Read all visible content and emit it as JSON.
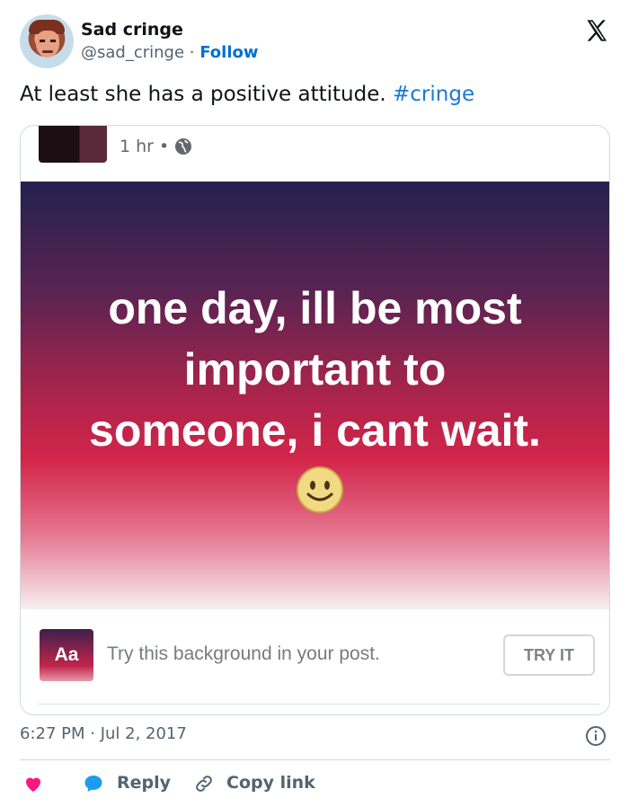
{
  "author": {
    "display_name": "Sad cringe",
    "handle": "@sad_cringe",
    "separator": " · ",
    "follow_label": "Follow"
  },
  "logo_icon": "x-logo-icon",
  "tweet": {
    "text": "At least she has a positive attitude. ",
    "hashtag": "#cringe"
  },
  "embedded_post": {
    "time": "1 hr",
    "dot": "•",
    "privacy_icon": "globe-icon",
    "lines": [
      "one day, ill be most",
      "important to",
      "someone, i cant wait."
    ],
    "emoji": "smiley-icon",
    "background_colors": [
      "#24214f",
      "#5a2352",
      "#d3254a",
      "#f6f0f2"
    ]
  },
  "background_promo": {
    "badge": "Aa",
    "text": "Try this background in your post.",
    "button_label": "TRY IT"
  },
  "footer": {
    "timestamp": "6:27 PM · Jul 2, 2017",
    "info_icon": "info-icon"
  },
  "actions": {
    "like_icon": "heart-icon",
    "reply_icon": "reply-bubble-icon",
    "reply_label": "Reply",
    "copy_icon": "link-icon",
    "copy_label": "Copy link"
  },
  "colors": {
    "link_blue": "#006fd6",
    "hashtag_blue": "#1d77d2",
    "heart_pink": "#f91880",
    "muted": "#536471"
  }
}
